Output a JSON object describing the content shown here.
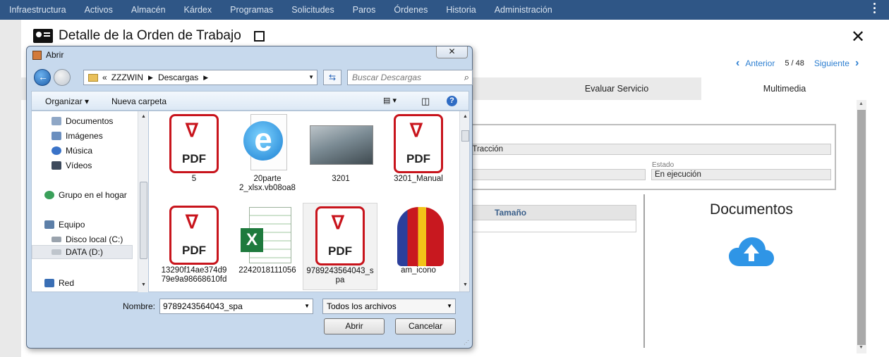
{
  "topnav": {
    "items": [
      "Infraestructura",
      "Activos",
      "Almacén",
      "Kárdex",
      "Programas",
      "Solicitudes",
      "Paros",
      "Órdenes",
      "Historia",
      "Administración"
    ]
  },
  "page": {
    "title": "Detalle de la Orden de Trabajo",
    "pager": {
      "prev": "Anterior",
      "count": "5 / 48",
      "next": "Siguiente"
    },
    "tabs": [
      "Evaluar Servicio",
      "Multimedia"
    ],
    "active_tab": "Multimedia",
    "form": {
      "field_partial_value": "a Tracción",
      "estado_label": "Estado",
      "estado_value": "En ejecución"
    },
    "files_table": {
      "header": "Tamaño"
    },
    "documents": {
      "title": "Documentos"
    }
  },
  "dialog": {
    "title": "Abrir",
    "close_label": "✕",
    "address": {
      "prefix": "«",
      "parts": [
        "ZZZWIN",
        "Descargas"
      ]
    },
    "search_placeholder": "Buscar Descargas",
    "toolbar": {
      "organize": "Organizar",
      "new_folder": "Nueva carpeta"
    },
    "nav_items": [
      {
        "label": "Documentos",
        "icon": "documents-icon"
      },
      {
        "label": "Imágenes",
        "icon": "pictures-icon"
      },
      {
        "label": "Música",
        "icon": "music-icon"
      },
      {
        "label": "Vídeos",
        "icon": "videos-icon"
      },
      {
        "label": "Grupo en el hogar",
        "icon": "homegroup-icon"
      },
      {
        "label": "Equipo",
        "icon": "computer-icon"
      },
      {
        "label": "Disco local (C:)",
        "icon": "drive-icon"
      },
      {
        "label": "DATA (D:)",
        "icon": "drive-icon"
      },
      {
        "label": "Red",
        "icon": "network-icon"
      }
    ],
    "selected_nav": "DATA (D:)",
    "files": [
      {
        "name": "5",
        "type": "pdf"
      },
      {
        "name": "20parte 2_xlsx.vb08oa8",
        "type": "ie"
      },
      {
        "name": "3201",
        "type": "image"
      },
      {
        "name": "3201_Manual",
        "type": "pdf"
      },
      {
        "name": "13290f14ae374d9 79e9a98668610fd",
        "type": "pdf"
      },
      {
        "name": "2242018111056",
        "type": "excel"
      },
      {
        "name": "9789243564043_s pa",
        "type": "pdf"
      },
      {
        "name": "am_icono",
        "type": "logo"
      }
    ],
    "filename_label": "Nombre:",
    "filename_value": "9789243564043_spa",
    "filetype_value": "Todos los archivos",
    "open_button": "Abrir",
    "cancel_button": "Cancelar"
  },
  "colors": {
    "topnav_bg": "#2f5686",
    "link": "#2d7fd1",
    "pdf_red": "#c8141c",
    "upload_blue": "#2f95e6"
  }
}
